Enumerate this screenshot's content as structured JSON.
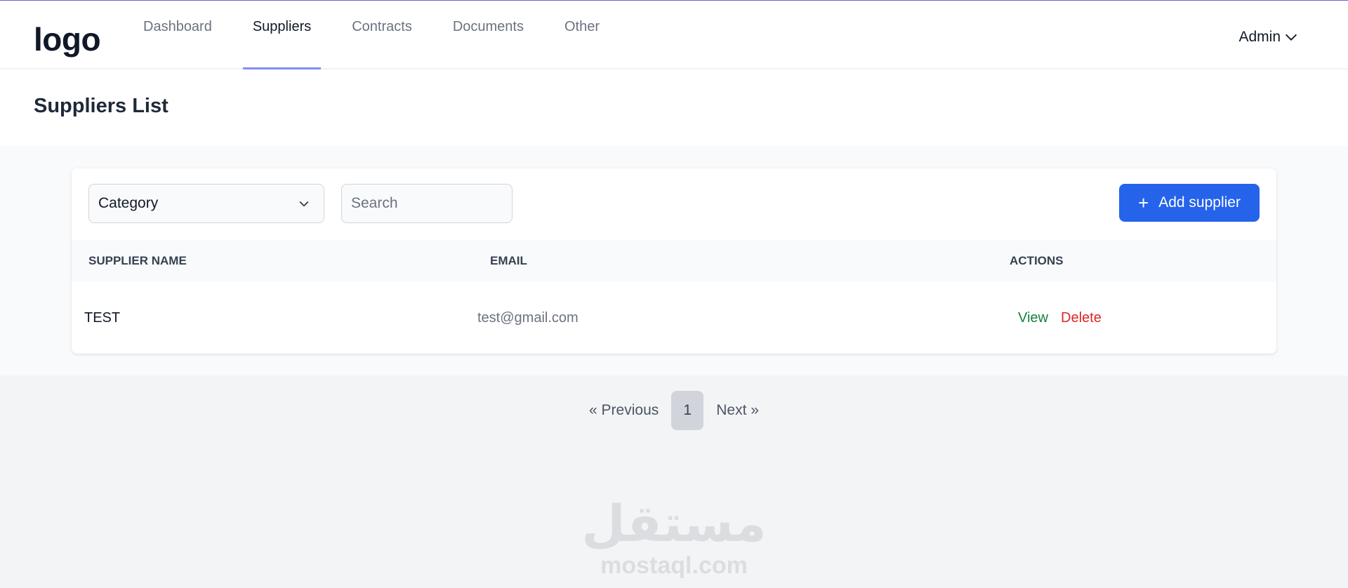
{
  "header": {
    "logo": "logo",
    "nav": [
      {
        "label": "Dashboard",
        "active": false
      },
      {
        "label": "Suppliers",
        "active": true
      },
      {
        "label": "Contracts",
        "active": false
      },
      {
        "label": "Documents",
        "active": false
      },
      {
        "label": "Other",
        "active": false
      }
    ],
    "user_menu": {
      "label": "Admin",
      "icon": "chevron-down-icon"
    }
  },
  "page": {
    "title": "Suppliers List"
  },
  "toolbar": {
    "category_select": {
      "value": "Category",
      "icon": "chevron-down-icon"
    },
    "search": {
      "placeholder": "Search",
      "value": ""
    },
    "add_button": {
      "label": "Add supplier",
      "icon": "plus-icon"
    }
  },
  "table": {
    "columns": [
      "SUPPLIER NAME",
      "EMAIL",
      "ACTIONS"
    ],
    "rows": [
      {
        "name": "TEST",
        "email": "test@gmail.com",
        "actions": [
          "View",
          "Delete"
        ]
      }
    ]
  },
  "pagination": {
    "previous": "« Previous",
    "current": "1",
    "next": "Next »"
  },
  "watermark": {
    "arabic": "مستقل",
    "latin": "mostaql.com"
  },
  "colors": {
    "accent": "#818cf8",
    "primary_button": "#2563eb",
    "view_link": "#15803d",
    "delete_link": "#dc2626"
  }
}
